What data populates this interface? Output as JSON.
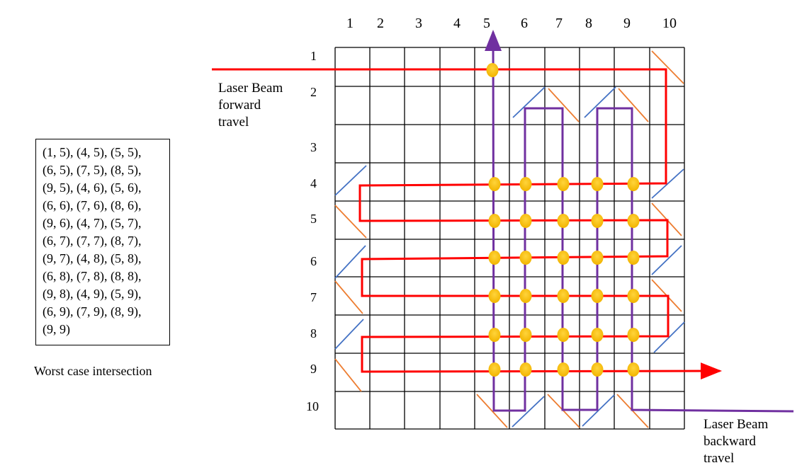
{
  "column_labels": [
    "1",
    "2",
    "3",
    "4",
    "5",
    "6",
    "7",
    "8",
    "9",
    "10"
  ],
  "row_labels": [
    "1",
    "2",
    "3",
    "4",
    "5",
    "6",
    "7",
    "8",
    "9",
    "10"
  ],
  "forward_label": [
    "Laser Beam",
    "forward",
    "travel"
  ],
  "backward_label": [
    "Laser Beam",
    "backward",
    "travel"
  ],
  "intersection_list": [
    "(1, 5), (4, 5), (5, 5),",
    "(6, 5), (7, 5), (8, 5),",
    "(9, 5), (4, 6), (5, 6),",
    "(6, 6), (7, 6), (8, 6),",
    "(9, 6), (4, 7), (5, 7),",
    "(6, 7), (7, 7), (8, 7),",
    "(9, 7), (4, 8), (5, 8),",
    "(6, 8), (7, 8), (8, 8),",
    "(9, 8), (4, 9), (5, 9),",
    "(6, 9), (7, 9), (8, 9),",
    "(9, 9)"
  ],
  "caption": "Worst case intersection",
  "colors": {
    "forward_beam": "#ff0000",
    "backward_beam": "#7030a0",
    "intersection": "#ffc000",
    "mirror_blue": "#4472c4",
    "mirror_orange": "#ed7d31",
    "grid": "#000000"
  }
}
